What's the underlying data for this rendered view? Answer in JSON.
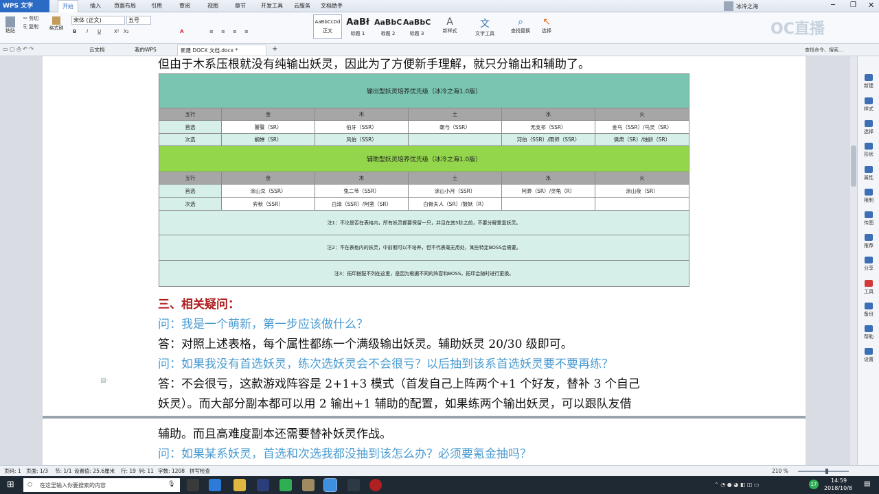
{
  "app": {
    "name": "WPS 文字",
    "user": "冰冷之海"
  },
  "menu": [
    "开始",
    "插入",
    "页面布局",
    "引用",
    "审阅",
    "视图",
    "章节",
    "开发工具",
    "云服务",
    "文档助手"
  ],
  "toolbar": {
    "paste": "粘贴",
    "cut": "剪切",
    "copy": "复制",
    "format_painter": "格式刷",
    "font": "宋体 (正文)",
    "size": "五号",
    "new_style": "新样式",
    "text_tools": "文字工具",
    "find_replace": "查找替换",
    "select": "选择"
  },
  "styles": [
    {
      "preview": "AaBbCcDd",
      "name": "正文"
    },
    {
      "preview": "AaBł",
      "name": "标题 1"
    },
    {
      "preview": "AaBbC",
      "name": "标题 2"
    },
    {
      "preview": "AaBbC",
      "name": "标题 3"
    }
  ],
  "tabs": [
    "云文档",
    "我的WPS",
    "新建 DOCX 文档.docx *"
  ],
  "command_search": "查找命令、搜索...",
  "watermark": "OC直播",
  "doc": {
    "intro": "但由于木系压根就没有纯输出妖灵，因此为了方便新手理解，就只分输出和辅助了。",
    "table1_title": "输出型妖灵培养优先级（冰冷之海1.0版）",
    "table2_title": "辅助型妖灵培养优先级（冰冷之海1.0版）",
    "header": [
      "五行",
      "金",
      "木",
      "土",
      "水",
      "火"
    ],
    "t1_rows": [
      [
        "首选",
        "饕餮（SR）",
        "伯牙（SSR）",
        "朝与（SSR）",
        "无支祁（SSR）",
        "金乌（SSR）/乌灵（SR）"
      ],
      [
        "次选",
        "娴婵（SR）",
        "风伯（SSR）",
        "",
        "河伯（SSR）/雨师（SSR）",
        "俱肃（SR）/烛龄（SR）"
      ]
    ],
    "t2_rows": [
      [
        "首选",
        "涂山爻（SSR）",
        "兔二爷（SSR）",
        "涂山小月（SSR）",
        "阿渺（SR）/灵龟（R）",
        "涂山夜（SR）"
      ],
      [
        "次选",
        "弈秋（SSR）",
        "白泽（SSR）/阿蛮（SR）",
        "白骨夫人（SR）/鼓妖（R）",
        "",
        ""
      ]
    ],
    "notes": [
      "注1：不论是否在表格内，所有妖灵都要保留一只，并且在其5阶之前，不要分解重复妖灵。",
      "注2：不在表格内的妖灵，中前期可以不培养，但不代表毫无用处，某些特定BOSS会需要。",
      "注3：拓印搭配不列在这里，是因为根据不同的阵容和BOSS，拓印会随时进行更换。"
    ],
    "section": "三、相关疑问：",
    "q1": "问：我是一个萌新，第一步应该做什么？",
    "a1": "答：对照上述表格，每个属性都练一个满级输出妖灵。辅助妖灵 20/30 级即可。",
    "q2": "问：如果我没有首选妖灵，练次选妖灵会不会很亏？以后抽到该系首选妖灵要不要再练？",
    "a2_l1": "答：不会很亏，这款游戏阵容是 2+1+3 模式（首发自己上阵两个+1 个好友，替补 3 个自己",
    "a2_l2": "妖灵）。而大部分副本都可以用 2 输出+1 辅助的配置，如果练两个输出妖灵，可以跟队友借",
    "a2_l3": "辅助。而且高难度副本还需要替补妖灵作战。",
    "q3": "问：如果某系妖灵，首选和次选我都没抽到该怎么办？必须要氪金抽吗？"
  },
  "sidebar": [
    "新建",
    "样式",
    "选择",
    "形状",
    "属性",
    "限制",
    "传图",
    "推荐",
    "分享",
    "工具",
    "备份",
    "帮助",
    "设置"
  ],
  "status": {
    "page": "页码: 1",
    "pages": "页面: 1/3",
    "section": "节: 1/1",
    "setting": "设置值: 25.6厘米",
    "row": "行: 19",
    "col": "列: 11",
    "words": "字数: 1208",
    "spell": "拼写检查",
    "zoom": "210 %"
  },
  "taskbar": {
    "search": "在这里输入你要搜索的内容",
    "time": "14:59",
    "date": "2018/10/8",
    "badge": "17"
  }
}
